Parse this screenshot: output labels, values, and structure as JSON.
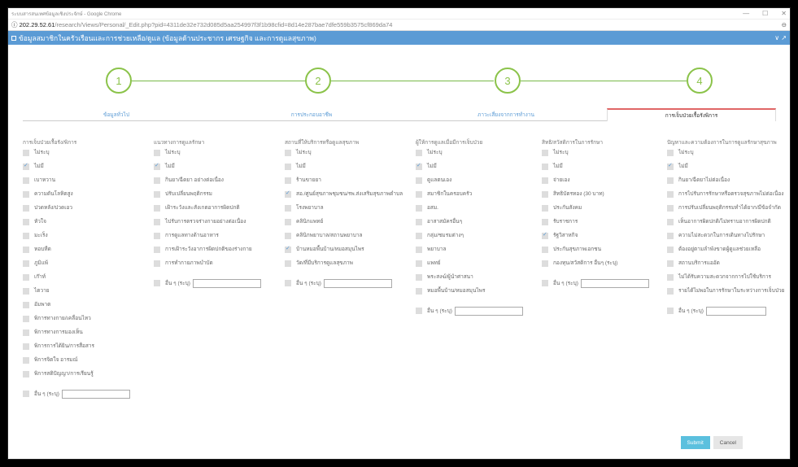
{
  "window": {
    "title": "ระบบสารสนเทศข้อมูลเชิงประจักษ์ - Google Chrome",
    "minimize": "—",
    "maximize": "☐",
    "close": "✕"
  },
  "url": {
    "icon": "info-icon",
    "host": "202.29.52.61",
    "path": "/research/Views/Personal/_Edit.php?pid=4311de32e732d085d5aa254997f3f1b98cfid=8d14e287bae7dfe559b3575cf869da74",
    "right": "⊖"
  },
  "header": {
    "title": "ข้อมูลสมาชิกในครัวเรือนและการช่วยเหลือ/ดูแล (ข้อมูลด้านประชากร เศรษฐกิจ และการดูแลสุขภาพ)",
    "collapse": "∨ ↗"
  },
  "steps": [
    "1",
    "2",
    "3",
    "4"
  ],
  "tabs": [
    "ข้อมูลทั่วไป",
    "การประกอบอาชีพ",
    "ภาวะเสี่ยงจากการทำงาน",
    "การเจ็บป่วยเรื้อรังพิการ"
  ],
  "columns": [
    {
      "header": "การเจ็บป่วยเรื้อรัง/พิการ",
      "options": [
        {
          "label": "ไม่ระบุ",
          "checked": false
        },
        {
          "label": "ไม่มี",
          "checked": true
        },
        {
          "label": "เบาหวาน",
          "checked": false
        },
        {
          "label": "ความดันโลหิตสูง",
          "checked": false
        },
        {
          "label": "ปวดหลัง/ปวดเอว",
          "checked": false
        },
        {
          "label": "หัวใจ",
          "checked": false
        },
        {
          "label": "มะเร็ง",
          "checked": false
        },
        {
          "label": "หอบหืด",
          "checked": false
        },
        {
          "label": "ภูมิแพ้",
          "checked": false
        },
        {
          "label": "เก๊าท์",
          "checked": false
        },
        {
          "label": "ไตวาย",
          "checked": false
        },
        {
          "label": "อัมพาต",
          "checked": false
        },
        {
          "label": "พิการทางกาย/เคลื่อนไหว",
          "checked": false
        },
        {
          "label": "พิการทางการมองเห็น",
          "checked": false
        },
        {
          "label": "พิการการได้ยิน/การสื่อสาร",
          "checked": false
        },
        {
          "label": "พิการจิตใจ อารมณ์",
          "checked": false
        },
        {
          "label": "พิการสติปัญญา/การเรียนรู้",
          "checked": false
        }
      ],
      "other_label": "อื่น ๆ (ระบุ)"
    },
    {
      "header": "แนวทางการดูแลรักษา",
      "options": [
        {
          "label": "ไม่ระบุ",
          "checked": false
        },
        {
          "label": "ไม่มี",
          "checked": true
        },
        {
          "label": "กินยา/ฉีดยา อย่างต่อเนื่อง",
          "checked": false
        },
        {
          "label": "ปรับเปลี่ยนพฤติกรรม",
          "checked": false
        },
        {
          "label": "เฝ้าระวังและสังเกตอาการผิดปกติ",
          "checked": false
        },
        {
          "label": "ไปรับการตรวจร่างกายอย่างต่อเนื่อง",
          "checked": false
        },
        {
          "label": "การดูแลทางด้านอาหาร",
          "checked": false
        },
        {
          "label": "การเฝ้าระวังอาการผิดปกติของร่างกาย",
          "checked": false
        },
        {
          "label": "การทำกายภาพบำบัด",
          "checked": false
        }
      ],
      "other_label": "อื่น ๆ (ระบุ)"
    },
    {
      "header": "สถานที่ให้บริการหรือดูแลสุขภาพ",
      "options": [
        {
          "label": "ไม่ระบุ",
          "checked": false
        },
        {
          "label": "ไม่มี",
          "checked": false
        },
        {
          "label": "ร้านขายยา",
          "checked": false
        },
        {
          "label": "สอ./ศูนย์สุขภาพชุมชน/รพ.ส่งเสริมสุขภาพตำบล",
          "checked": true
        },
        {
          "label": "โรงพยาบาล",
          "checked": false
        },
        {
          "label": "คลินิกแพทย์",
          "checked": false
        },
        {
          "label": "คลินิกพยาบาล/สถานพยาบาล",
          "checked": false
        },
        {
          "label": "บ้านหมอพื้นบ้าน/หมอสมุนไพร",
          "checked": true
        },
        {
          "label": "วัด/ที่มีบริการดูแลสุขภาพ",
          "checked": false
        }
      ],
      "other_label": "อื่น ๆ (ระบุ)"
    },
    {
      "header": "ผู้ให้การดูแลเมื่อมีการเจ็บป่วย",
      "options": [
        {
          "label": "ไม่ระบุ",
          "checked": false
        },
        {
          "label": "ไม่มี",
          "checked": true
        },
        {
          "label": "ดูแลตนเอง",
          "checked": false
        },
        {
          "label": "สมาชิกในครอบครัว",
          "checked": false
        },
        {
          "label": "อสม.",
          "checked": false
        },
        {
          "label": "อาสาสมัครอื่นๆ",
          "checked": false
        },
        {
          "label": "กลุ่ม/ชมรมต่างๆ",
          "checked": false
        },
        {
          "label": "พยาบาล",
          "checked": false
        },
        {
          "label": "แพทย์",
          "checked": false
        },
        {
          "label": "พระสงฆ์/ผู้นำศาสนา",
          "checked": false
        },
        {
          "label": "หมอพื้นบ้าน/หมอสมุนไพร",
          "checked": false
        }
      ],
      "other_label": "อื่น ๆ (ระบุ)"
    },
    {
      "header": "สิทธิ/สวัสดิการในการรักษา",
      "options": [
        {
          "label": "ไม่ระบุ",
          "checked": false
        },
        {
          "label": "ไม่มี",
          "checked": false
        },
        {
          "label": "จ่ายเอง",
          "checked": false
        },
        {
          "label": "สิทธิบัตรทอง (30 บาท)",
          "checked": false
        },
        {
          "label": "ประกันสังคม",
          "checked": false
        },
        {
          "label": "รับราชการ",
          "checked": false
        },
        {
          "label": "รัฐวิสาหกิจ",
          "checked": true
        },
        {
          "label": "ประกันสุขภาพเอกชน",
          "checked": false
        },
        {
          "label": "กองทุน/สวัสดิการ อื่นๆ (ระบุ)",
          "checked": false
        }
      ],
      "other_label": "อื่น ๆ (ระบุ)"
    },
    {
      "header": "ปัญหาและความต้องการในการดูแลรักษาสุขภาพ",
      "options": [
        {
          "label": "ไม่ระบุ",
          "checked": false
        },
        {
          "label": "ไม่มี",
          "checked": true
        },
        {
          "label": "กินยา/ฉีดยาไม่ต่อเนื่อง",
          "checked": false
        },
        {
          "label": "การไปรับการรักษาหรือตรวจสุขภาพไม่ต่อเนื่อง",
          "checked": false
        },
        {
          "label": "การปรับเปลี่ยนพฤติกรรมทำได้ยาก/มีข้อจำกัด",
          "checked": false
        },
        {
          "label": "เห็นอาการผิดปกติ/ไม่ทราบอาการผิดปกติ",
          "checked": false
        },
        {
          "label": "ความไม่สะดวกในการเดินทางไปรักษา",
          "checked": false
        },
        {
          "label": "ต้องอยู่ตามลำพังขาดผู้ดูแลช่วยเหลือ",
          "checked": false
        },
        {
          "label": "สถานบริการแออัด",
          "checked": false
        },
        {
          "label": "ไม่ได้รับความสะดวกจากการไปใช้บริการ",
          "checked": false
        },
        {
          "label": "รายได้ไม่พอในการรักษาในระหว่างการเจ็บป่วย",
          "checked": false
        }
      ],
      "other_label": "อื่น ๆ (ระบุ)"
    }
  ],
  "buttons": {
    "submit": "Submit",
    "cancel": "Cancel"
  },
  "colors": {
    "header": "#5b9bd5",
    "step": "#8bc34a",
    "active_tab": "#e06666",
    "submit": "#5bc0de"
  }
}
